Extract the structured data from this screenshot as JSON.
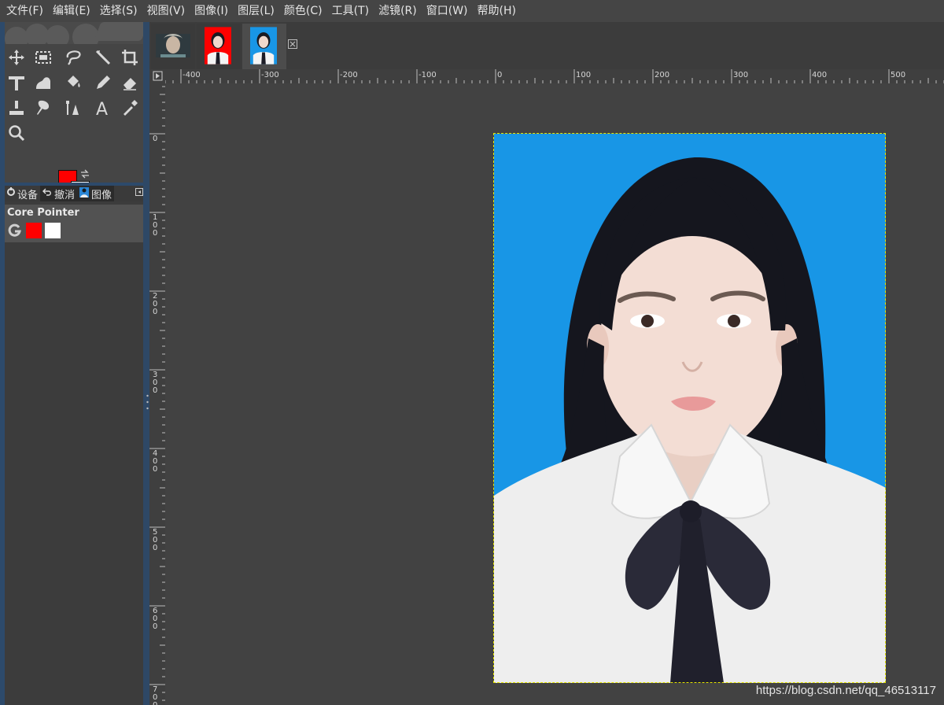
{
  "menubar": {
    "items": [
      "文件(F)",
      "编辑(E)",
      "选择(S)",
      "视图(V)",
      "图像(I)",
      "图层(L)",
      "颜色(C)",
      "工具(T)",
      "滤镜(R)",
      "窗口(W)",
      "帮助(H)"
    ]
  },
  "colors": {
    "foreground": "#ff0000",
    "background": "#ffffff",
    "photo_backdrop": "#1896e6"
  },
  "toolbox": {
    "tools": [
      "move-tool",
      "rect-select-tool",
      "free-select-tool",
      "fuzzy-select-tool",
      "crop-tool",
      "unified-transform-tool",
      "warp-transform-tool",
      "bucket-fill-tool",
      "pencil-tool",
      "eraser-tool",
      "clone-tool",
      "smudge-tool",
      "paths-tool",
      "text-tool",
      "color-picker-tool",
      "zoom-tool"
    ]
  },
  "dock": {
    "tabs": [
      {
        "label": "设备",
        "icon": "device-icon"
      },
      {
        "label": "撤消",
        "icon": "undo-icon"
      },
      {
        "label": "图像",
        "icon": "image-icon"
      }
    ],
    "device_name": "Core Pointer"
  },
  "image_tabs": [
    {
      "name": "portrait-tab-1",
      "bg": "#3a3a3a"
    },
    {
      "name": "portrait-tab-2",
      "bg": "#ff0000"
    },
    {
      "name": "portrait-tab-3",
      "bg": "#1896e6"
    }
  ],
  "ruler": {
    "top_labels": [
      "-400",
      "-300",
      "-200",
      "-100",
      "0",
      "100",
      "200",
      "300",
      "400",
      "500"
    ],
    "left_labels": [
      "0",
      "100",
      "200",
      "300",
      "400",
      "500",
      "600",
      "700"
    ]
  },
  "watermark": "https://blog.csdn.net/qq_46513117"
}
